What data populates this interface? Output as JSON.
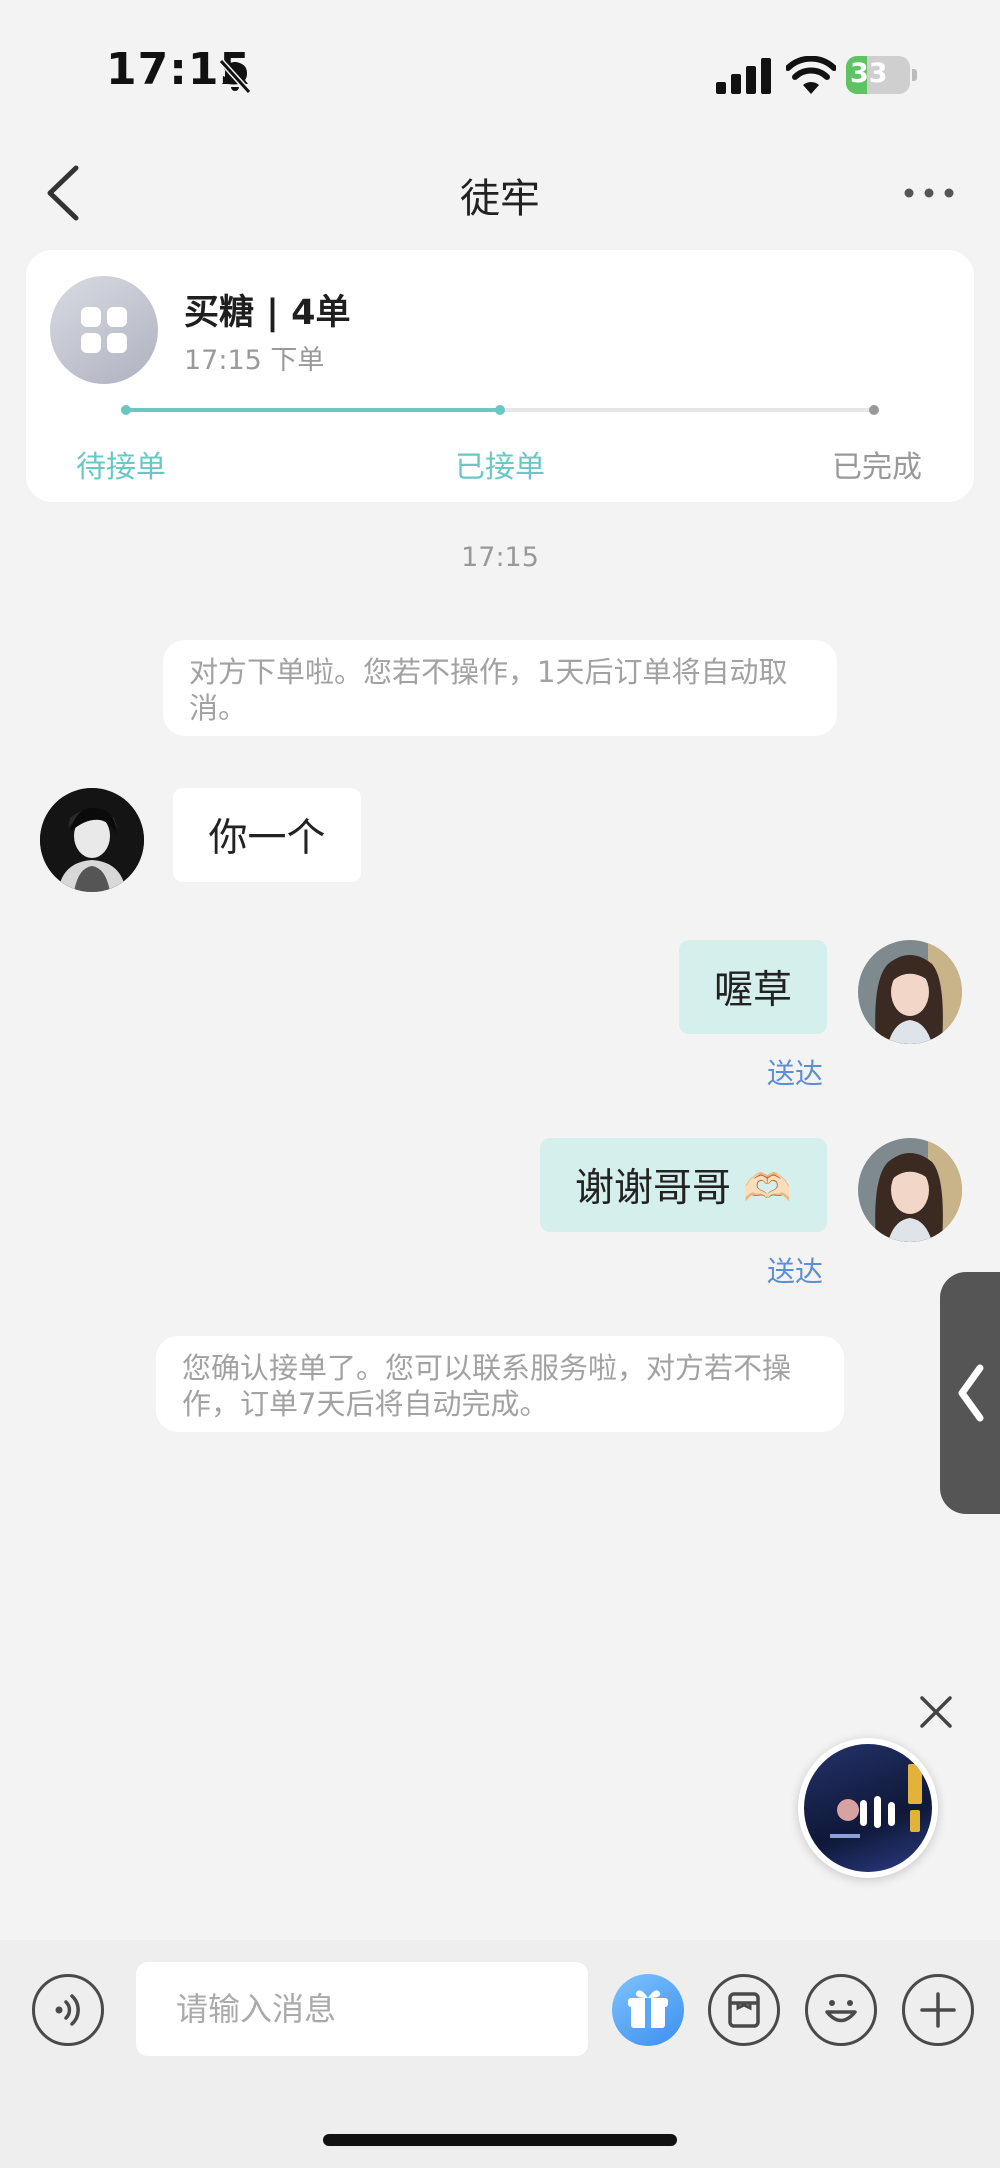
{
  "status_bar": {
    "time": "17:15",
    "battery": "33",
    "battery_level": 0.33
  },
  "nav": {
    "title": "徒牢"
  },
  "order": {
    "title": "买糖 | 4单",
    "time": "17:15 下单",
    "steps": [
      "待接单",
      "已接单",
      "已完成"
    ],
    "current_step_index": 1,
    "colors": {
      "active": "#6ac8c4",
      "inactive": "#999999"
    }
  },
  "chat": {
    "timestamp": "17:15",
    "notice_1": "对方下单啦。您若不操作，1天后订单将自动取消。",
    "msg_left_1": "你一个",
    "msg_right_1": "喔草",
    "msg_right_1_status": "送达",
    "msg_right_2": "谢谢哥哥 🫶🏻",
    "msg_right_2_status": "送达",
    "notice_2": "您确认接单了。您可以联系服务啦，对方若不操作，订单7天后将自动完成。"
  },
  "input": {
    "placeholder": "请输入消息"
  },
  "icons": {
    "voice": "voice-wave-icon",
    "gift": "gift-icon",
    "bag": "shopping-bag-icon",
    "emoji": "emoji-icon",
    "plus": "plus-icon"
  }
}
